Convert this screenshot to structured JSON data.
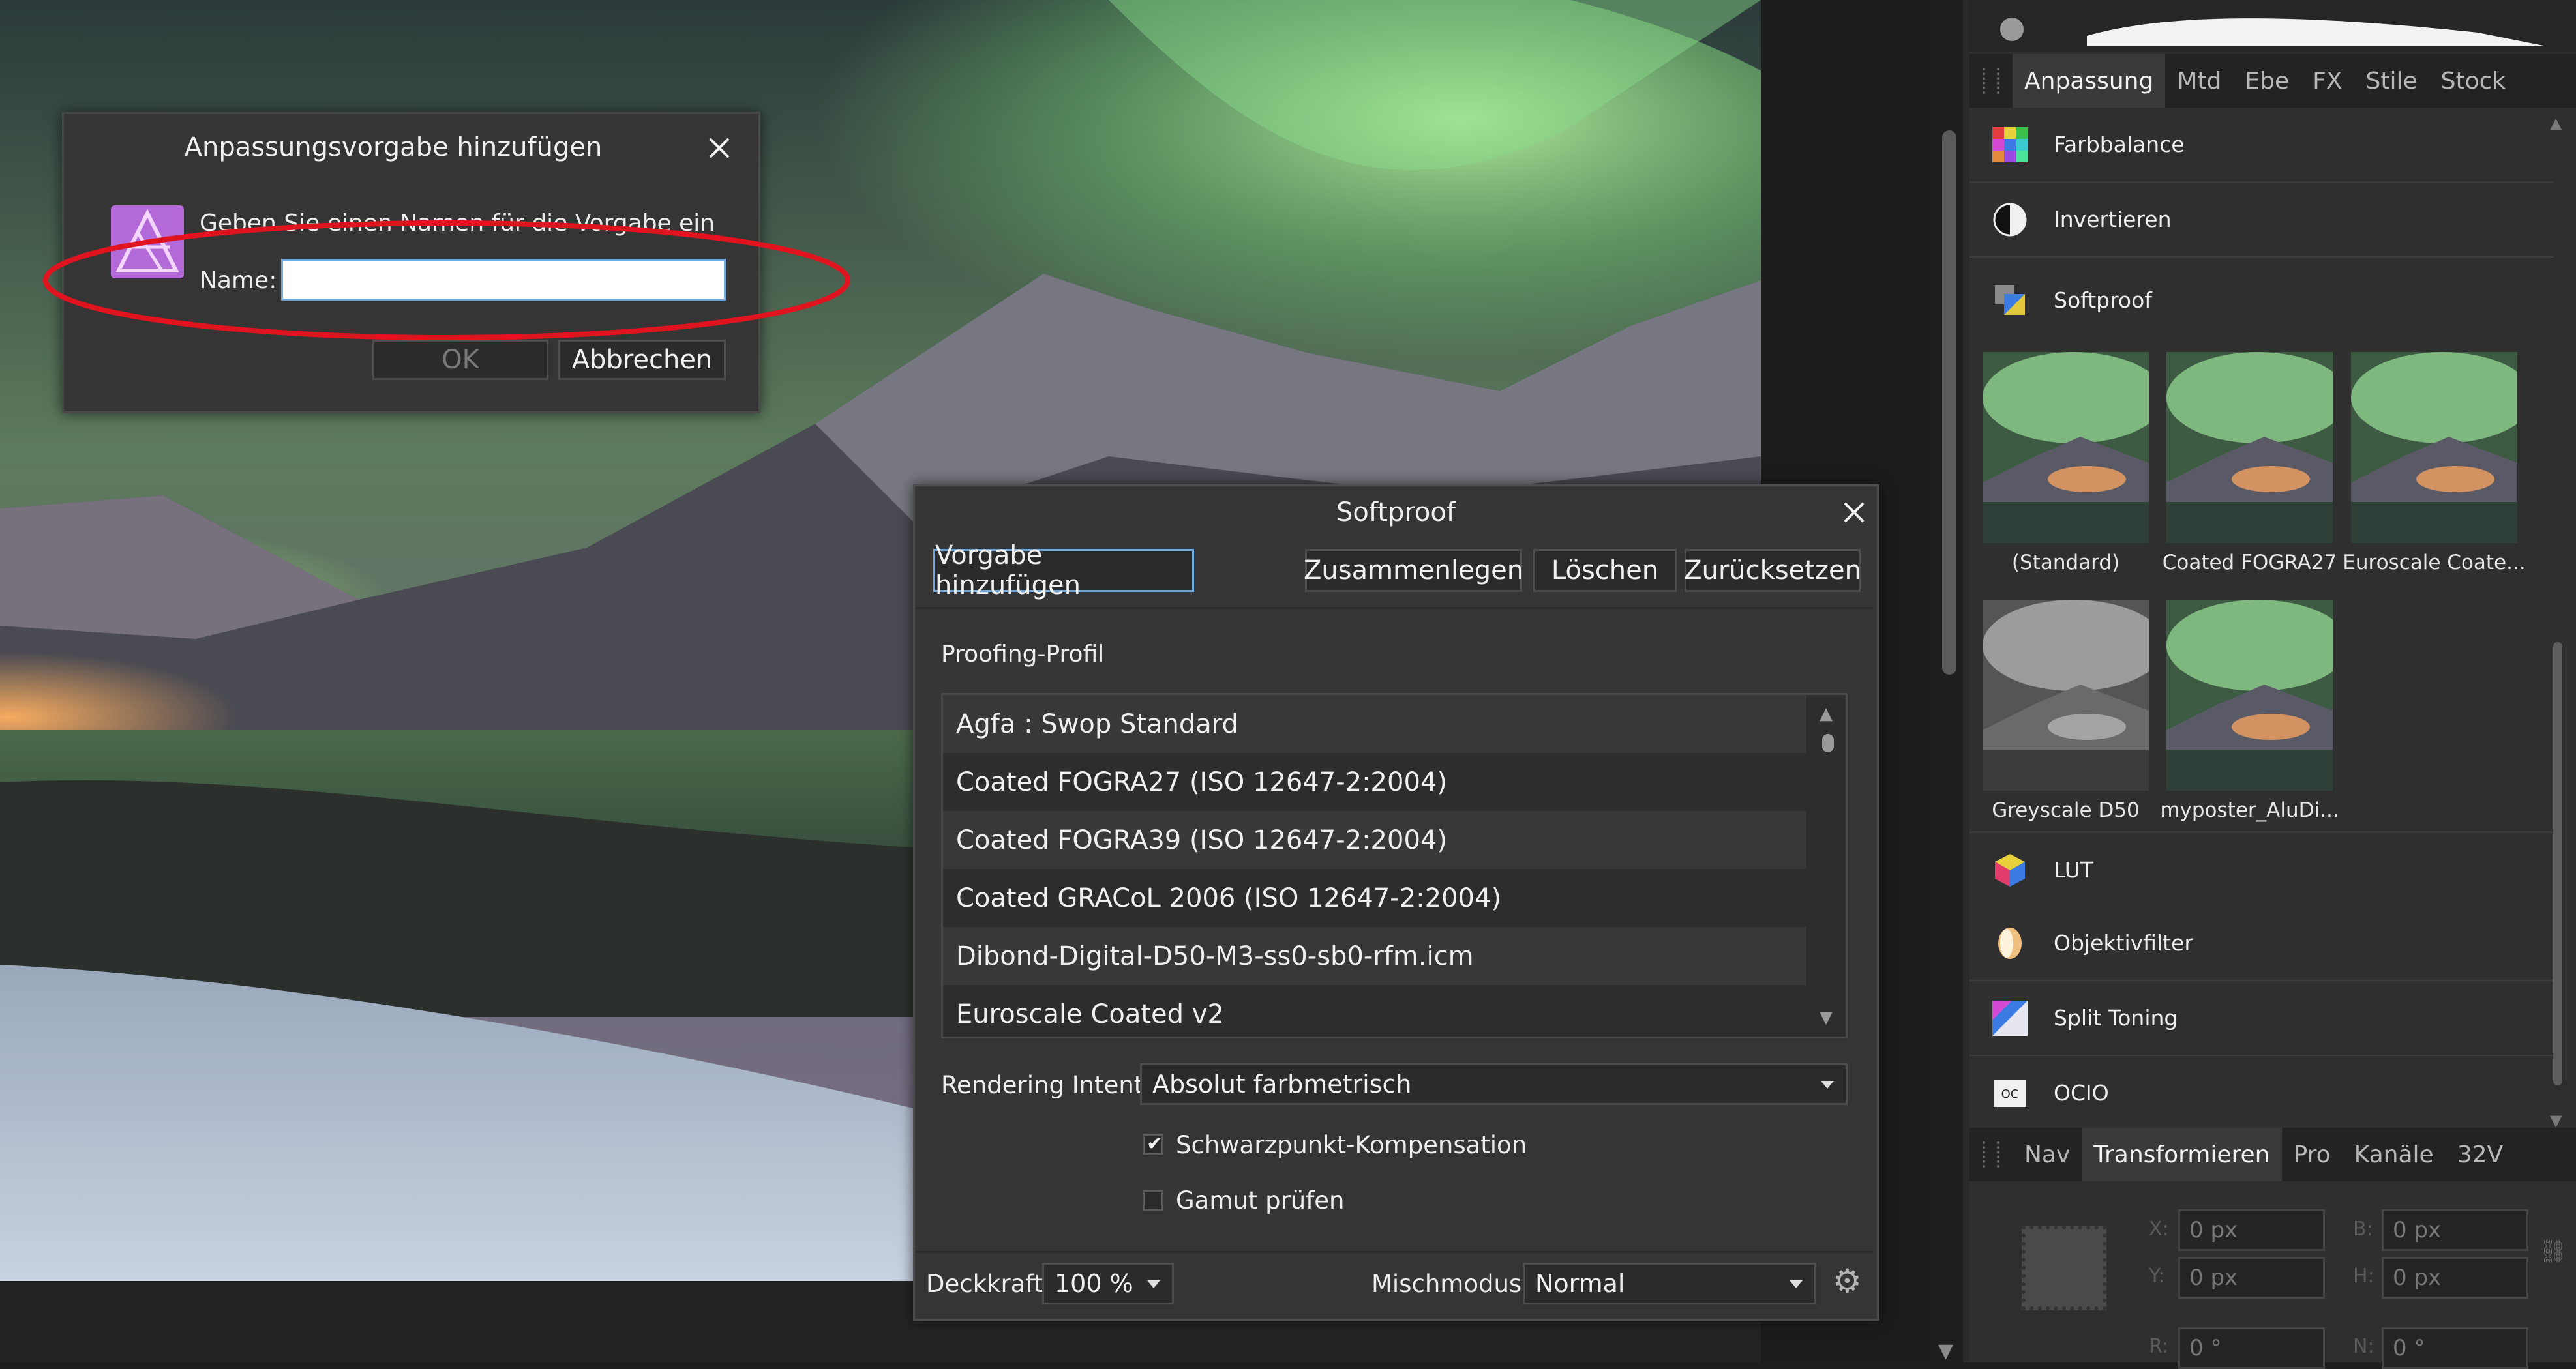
{
  "preset_dialog": {
    "title": "Anpassungsvorgabe hinzufügen",
    "prompt": "Geben Sie einen Namen für die Vorgabe ein",
    "name_label": "Name:",
    "name_value": "",
    "ok_label": "OK",
    "cancel_label": "Abbrechen"
  },
  "softproof_dialog": {
    "title": "Softproof",
    "buttons": {
      "add_preset": "Vorgabe hinzufügen",
      "merge": "Zusammenlegen",
      "delete": "Löschen",
      "reset": "Zurücksetzen"
    },
    "profile_label": "Proofing-Profil",
    "profiles": [
      "Agfa : Swop Standard",
      "Coated FOGRA27 (ISO 12647-2:2004)",
      "Coated FOGRA39 (ISO 12647-2:2004)",
      "Coated GRACoL 2006 (ISO 12647-2:2004)",
      "Dibond-Digital-D50-M3-ss0-sb0-rfm.icm",
      "Euroscale Coated v2"
    ],
    "rendering_intent_label": "Rendering Intent:",
    "rendering_intent_value": "Absolut farbmetrisch",
    "black_point_label": "Schwarzpunkt-Kompensation",
    "black_point_checked": true,
    "gamut_label": "Gamut prüfen",
    "gamut_checked": false,
    "opacity_label": "Deckkraft:",
    "opacity_value": "100 %",
    "blend_label": "Mischmodus:",
    "blend_value": "Normal"
  },
  "right_panel": {
    "top_tabs": [
      "Anpassung",
      "Mtd",
      "Ebe",
      "FX",
      "Stile",
      "Stock"
    ],
    "active_top_tab": "Anpassung",
    "adjustments_top": [
      {
        "label": "Farbbalance",
        "icon": "color-balance-icon"
      },
      {
        "label": "Invertieren",
        "icon": "invert-icon"
      },
      {
        "label": "Softproof",
        "icon": "softproof-icon"
      }
    ],
    "presets": [
      {
        "label": "(Standard)",
        "style": "color"
      },
      {
        "label": "Coated FOGRA27",
        "style": "color"
      },
      {
        "label": "Euroscale Coate...",
        "style": "color"
      },
      {
        "label": "Greyscale D50",
        "style": "grey"
      },
      {
        "label": "myposter_AluDi...",
        "style": "color"
      }
    ],
    "adjustments_bottom": [
      {
        "label": "LUT",
        "icon": "lut-icon"
      },
      {
        "label": "Objektivfilter",
        "icon": "lens-filter-icon"
      },
      {
        "label": "Split Toning",
        "icon": "split-toning-icon"
      },
      {
        "label": "OCIO",
        "icon": "ocio-icon"
      }
    ],
    "bottom_tabs": [
      "Nav",
      "Transformieren",
      "Pro",
      "Kanäle",
      "32V"
    ],
    "active_bottom_tab": "Transformieren",
    "transform": {
      "x_label": "X:",
      "x_value": "0 px",
      "y_label": "Y:",
      "y_value": "0 px",
      "w_label": "B:",
      "w_value": "0 px",
      "h_label": "H:",
      "h_value": "0 px",
      "r_label": "R:",
      "r_value": "0 °",
      "s_label": "N:",
      "s_value": "0 °"
    }
  },
  "colors": {
    "highlight_ellipse": "#e0141e",
    "focus_border": "#6fa8dc",
    "affinity_icon": "#b36ad8"
  }
}
